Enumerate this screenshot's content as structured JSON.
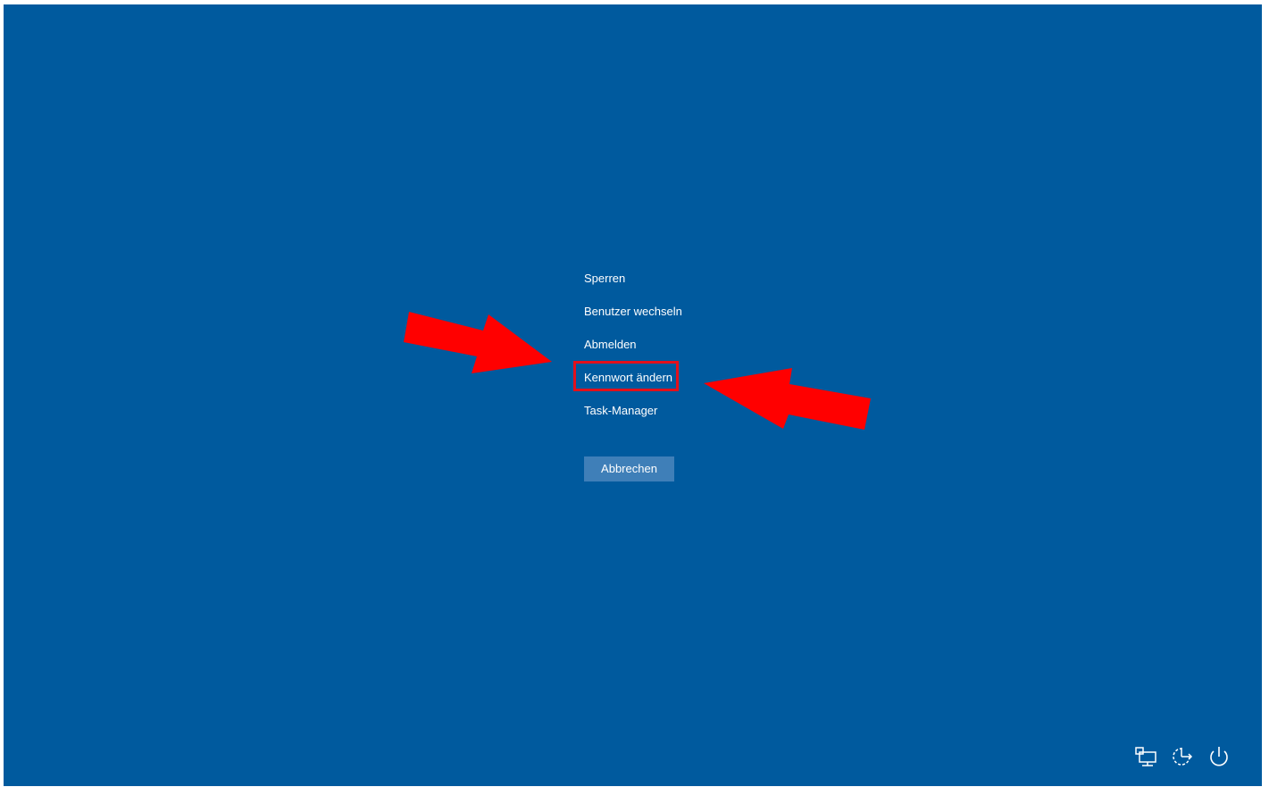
{
  "menu": {
    "items": [
      {
        "id": "lock",
        "label": "Sperren"
      },
      {
        "id": "switch-user",
        "label": "Benutzer wechseln"
      },
      {
        "id": "sign-out",
        "label": "Abmelden"
      },
      {
        "id": "change-password",
        "label": "Kennwort ändern"
      },
      {
        "id": "task-manager",
        "label": "Task-Manager"
      }
    ],
    "highlighted": "change-password"
  },
  "cancel_button": {
    "label": "Abbrechen"
  },
  "tray_icons": [
    "network-icon",
    "ease-of-access-icon",
    "power-icon"
  ],
  "colors": {
    "background": "#005a9e",
    "button": "#3f7fb8",
    "annotation": "#ff0000"
  }
}
